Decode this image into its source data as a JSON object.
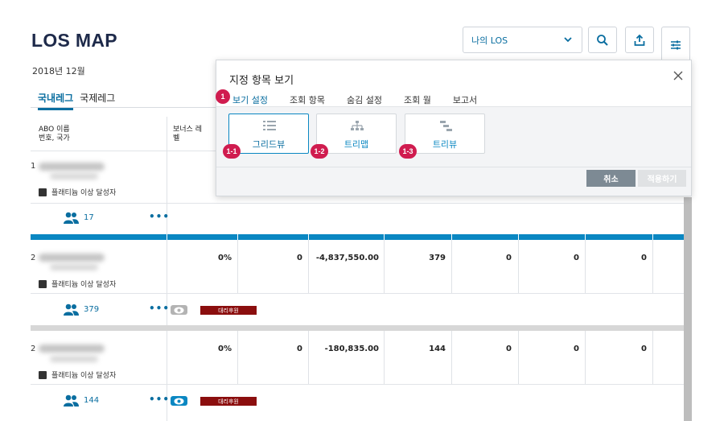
{
  "header": {
    "title": "LOS MAP",
    "month": "2018년 12월",
    "los_select": "나의 LOS"
  },
  "region_tabs": [
    "국내레그",
    "국제레그"
  ],
  "table": {
    "col_abo_line1": "ABO 이름",
    "col_abo_line2": "번호, 국가",
    "col_bonus_line1": "보너스 레",
    "col_bonus_line2": "벨"
  },
  "rows": [
    {
      "num": "1",
      "badge": "플래티늄 이상 달성자",
      "count": "17"
    },
    {
      "num": "2",
      "badge": "플래티늄 이상 달성자",
      "count": "379",
      "cells": [
        "0%",
        "0",
        "-4,837,550.00",
        "379",
        "0",
        "0",
        "0"
      ],
      "tag": "대리후원"
    },
    {
      "num": "2",
      "badge": "플래티늄 이상 달성자",
      "count": "144",
      "cells": [
        "0%",
        "0",
        "-180,835.00",
        "144",
        "0",
        "0",
        "0"
      ],
      "tag": "대리후원"
    }
  ],
  "popup": {
    "title": "지정 항목 보기",
    "tabs": [
      "보기 설정",
      "조회 항목",
      "숨김 설정",
      "조회 월",
      "보고서"
    ],
    "view_buttons": [
      {
        "label": "그리드뷰",
        "marker": "1-1",
        "icon": "list-icon"
      },
      {
        "label": "트리맵",
        "marker": "1-2",
        "icon": "org-chart-icon"
      },
      {
        "label": "트리뷰",
        "marker": "1-3",
        "icon": "tree-view-icon"
      }
    ],
    "tab_marker": "1",
    "cancel": "취소",
    "apply": "적용하기"
  },
  "colors": {
    "accent": "#0a6ea0",
    "band_blue": "#0a87c2",
    "marker": "#d01c4f",
    "tag": "#8b0e0e"
  }
}
